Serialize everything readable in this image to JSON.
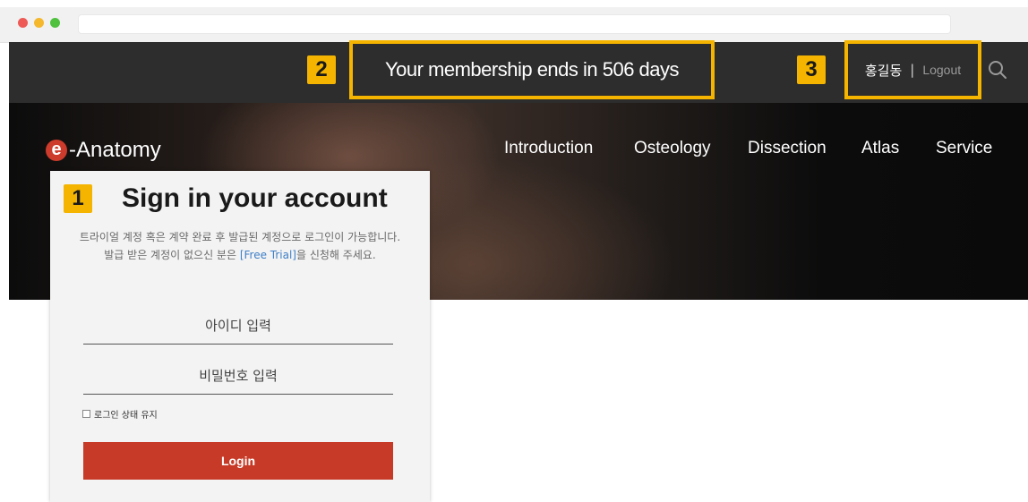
{
  "browser": {
    "dots": [
      "red",
      "yellow",
      "green"
    ]
  },
  "header": {
    "membership_text": "Your membership ends in 506 days",
    "username": "홍길동",
    "separator": "|",
    "logout_label": "Logout"
  },
  "annotations": {
    "badge1": "1",
    "badge2": "2",
    "badge3": "3",
    "highlight_color": "#f4b400"
  },
  "logo": {
    "letter": "e",
    "text": "-Anatomy"
  },
  "nav": {
    "items": [
      {
        "label": "Introduction"
      },
      {
        "label": "Osteology"
      },
      {
        "label": "Dissection"
      },
      {
        "label": "Atlas"
      },
      {
        "label": "Service"
      }
    ]
  },
  "login": {
    "title": "Sign in your account",
    "desc_line1": "트라이얼 계정 혹은 계약 완료 후 발급된 계정으로 로그인이 가능합니다.",
    "desc_line2_prefix": "발급 받은 계정이 없으신 분은 ",
    "desc_line2_link": "[Free Trial]",
    "desc_line2_suffix": "을 신청해 주세요.",
    "id_placeholder": "아이디 입력",
    "password_placeholder": "비밀번호 입력",
    "keep_signed_in": "로그인 상태 유지",
    "login_button": "Login"
  },
  "colors": {
    "accent_red": "#c73a27",
    "topbar_bg": "#2d2d2d",
    "link_blue": "#3e7fc7"
  }
}
